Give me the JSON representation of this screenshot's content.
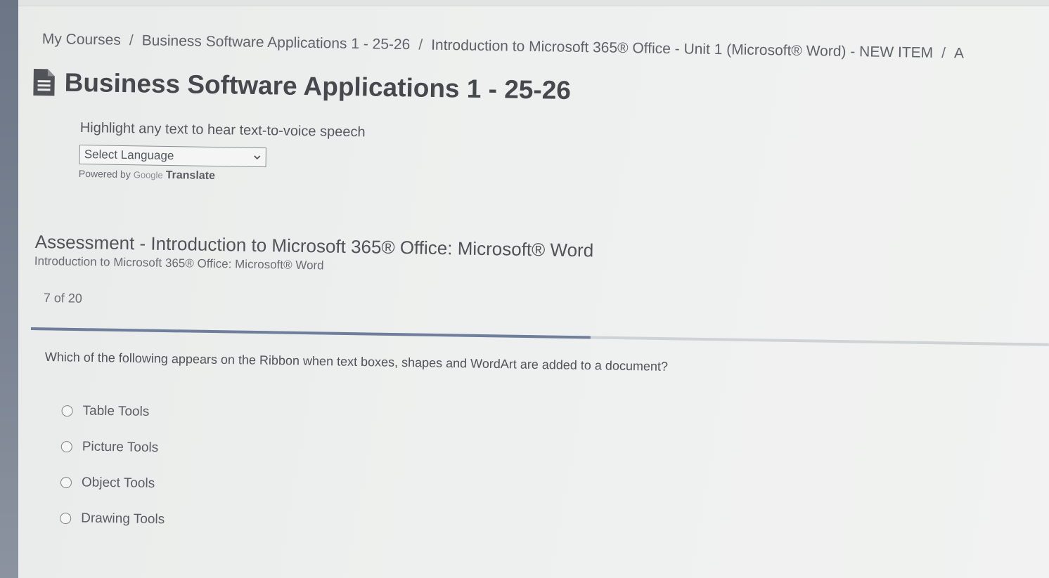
{
  "breadcrumb": {
    "items": [
      "My Courses",
      "Business Software Applications 1 - 25-26",
      "Introduction to Microsoft 365® Office - Unit 1 (Microsoft® Word) - NEW ITEM",
      "A"
    ],
    "separator": "/"
  },
  "page": {
    "icon": "document-icon",
    "title": "Business Software Applications 1 - 25-26"
  },
  "translate": {
    "tts_note": "Highlight any text to hear text-to-voice speech",
    "select_value": "Select Language",
    "powered_by": "Powered by",
    "google": "Google",
    "translate": "Translate"
  },
  "assessment": {
    "title": "Assessment - Introduction to Microsoft 365® Office: Microsoft® Word",
    "subtitle": "Introduction to Microsoft 365® Office: Microsoft® Word",
    "counter": "7 of 20",
    "progress_fraction": 0.55
  },
  "question": {
    "text": "Which of the following appears on the Ribbon when text boxes, shapes and WordArt are added to a document?",
    "options": [
      "Table Tools",
      "Picture Tools",
      "Object Tools",
      "Drawing Tools"
    ]
  },
  "colors": {
    "progress_fill": "#6f7f9b",
    "progress_track": "#cfd3d4",
    "left_rail": "#6b7585"
  }
}
